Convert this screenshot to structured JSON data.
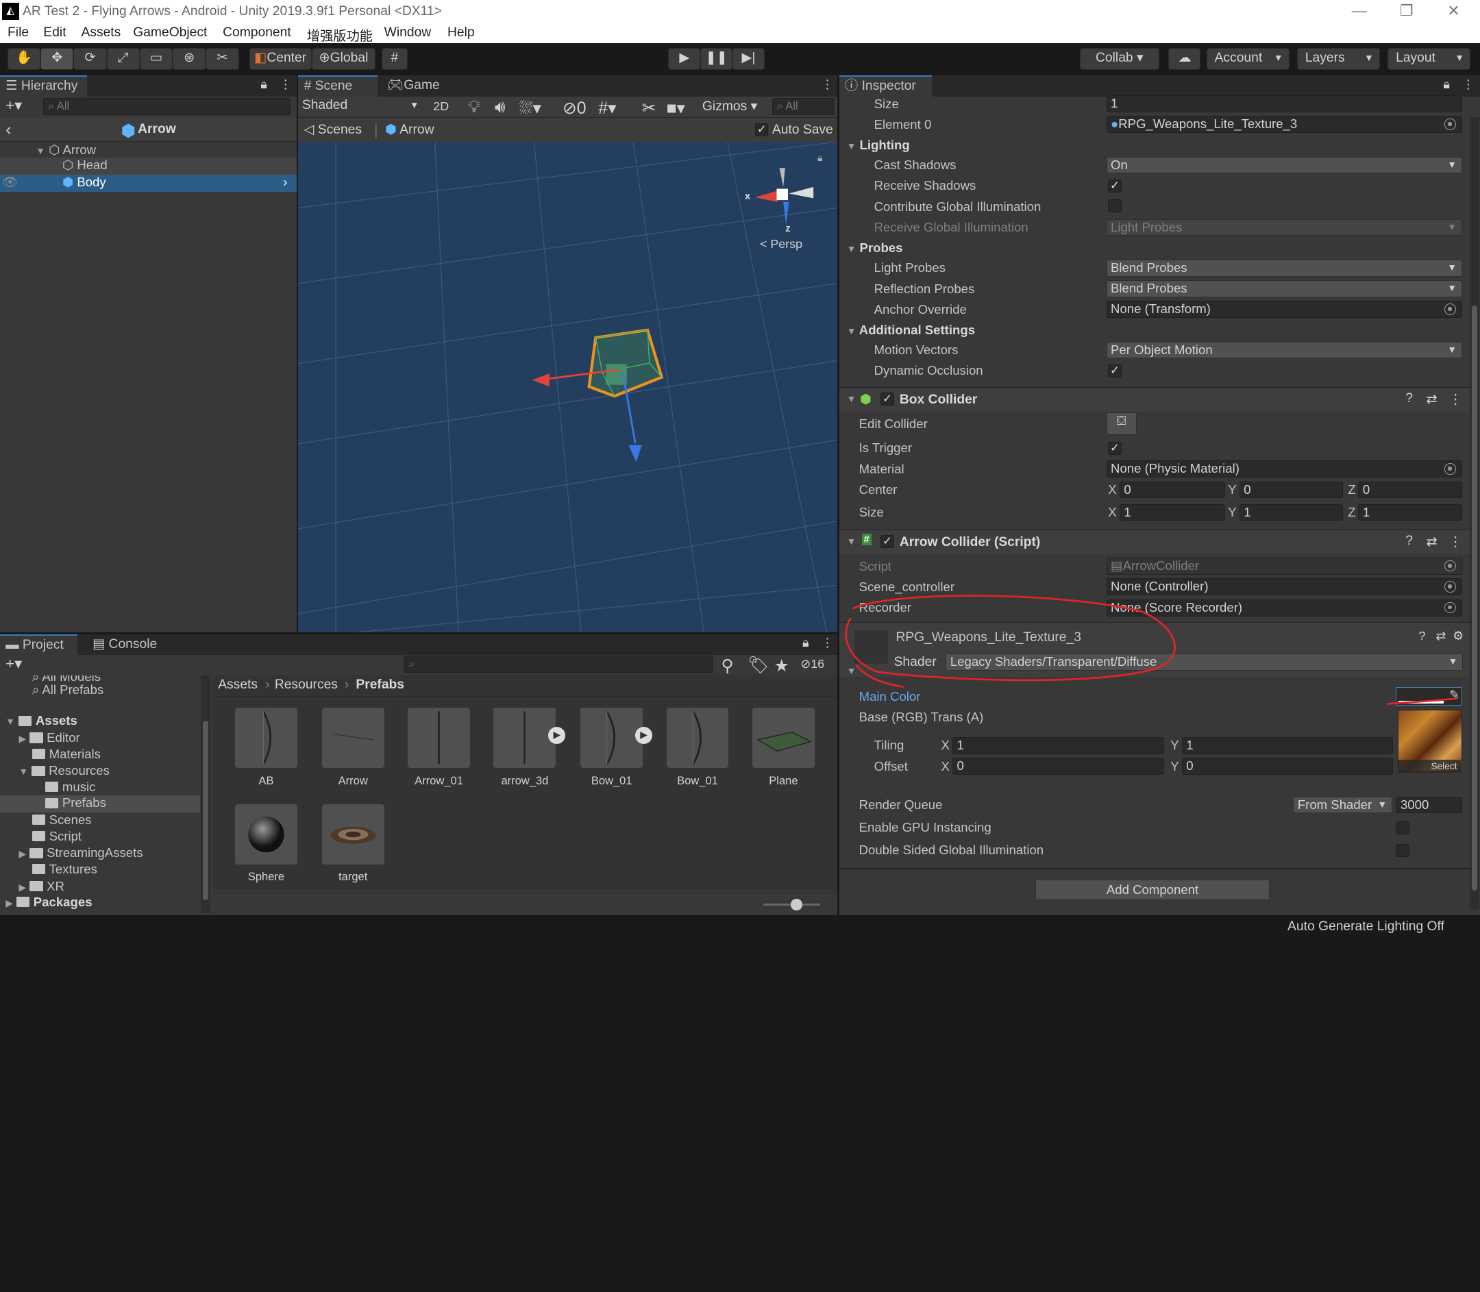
{
  "window": {
    "title": "AR Test 2 - Flying Arrows - Android - Unity 2019.3.9f1 Personal <DX11>",
    "icon": "unity-logo-icon"
  },
  "menu": [
    "File",
    "Edit",
    "Assets",
    "GameObject",
    "Component",
    "增强版功能",
    "Window",
    "Help"
  ],
  "toolbar": {
    "pivot": "Center",
    "space": "Global",
    "collab": "Collab ▾",
    "account": "Account",
    "layers": "Layers",
    "layout": "Layout"
  },
  "hierarchy": {
    "tab": "Hierarchy",
    "search_placeholder": "All",
    "scene_title": "Arrow",
    "items": [
      {
        "label": "Arrow"
      },
      {
        "label": "Head"
      },
      {
        "label": "Body"
      }
    ]
  },
  "scene": {
    "tabs": [
      "Scene",
      "Game"
    ],
    "shading": "Shaded",
    "mode2d": "2D",
    "hidden_count": "0",
    "gizmos": "Gizmos",
    "search_placeholder": "All",
    "breadcrumb": [
      "Scenes",
      "Arrow"
    ],
    "autosave": "Auto Save",
    "persp": "Persp",
    "axis_x": "x",
    "axis_z": "z"
  },
  "project": {
    "tabs": [
      "Project",
      "Console"
    ],
    "badge": "16",
    "tree": [
      "All Models",
      "All Prefabs",
      "Assets",
      "Editor",
      "Materials",
      "Resources",
      "music",
      "Prefabs",
      "Scenes",
      "Script",
      "StreamingAssets",
      "Textures",
      "XR",
      "Packages"
    ],
    "breadcrumb": [
      "Assets",
      "Resources",
      "Prefabs"
    ],
    "assets": [
      "AB",
      "Arrow",
      "Arrow_01",
      "arrow_3d",
      "Bow_01",
      "Bow_01",
      "Plane",
      "Sphere",
      "target"
    ]
  },
  "inspector": {
    "tab": "Inspector",
    "size_label": "Size",
    "size_value": "1",
    "element_label": "Element 0",
    "element_value": "RPG_Weapons_Lite_Texture_3",
    "lighting": "Lighting",
    "cast_shadows": "Cast Shadows",
    "cast_shadows_value": "On",
    "receive_shadows": "Receive Shadows",
    "contribute_gi": "Contribute Global Illumination",
    "receive_gi": "Receive Global Illumination",
    "receive_gi_value": "Light Probes",
    "probes": "Probes",
    "light_probes": "Light Probes",
    "light_probes_value": "Blend Probes",
    "reflection_probes": "Reflection Probes",
    "reflection_probes_value": "Blend Probes",
    "anchor_override": "Anchor Override",
    "anchor_override_value": "None (Transform)",
    "additional": "Additional Settings",
    "motion_vectors": "Motion Vectors",
    "motion_vectors_value": "Per Object Motion",
    "dynamic_occlusion": "Dynamic Occlusion",
    "box_collider": "Box Collider",
    "edit_collider": "Edit Collider",
    "is_trigger": "Is Trigger",
    "material": "Material",
    "material_value": "None (Physic Material)",
    "center": "Center",
    "size": "Size",
    "center_x": "0",
    "center_y": "0",
    "center_z": "0",
    "size_x": "1",
    "size_y": "1",
    "size_z": "1",
    "lbl_x": "X",
    "lbl_y": "Y",
    "lbl_z": "Z",
    "arrow_collider": "Arrow Collider (Script)",
    "script": "Script",
    "script_value": "ArrowCollider",
    "scene_controller": "Scene_controller",
    "scene_controller_value": "None (Controller)",
    "recorder": "Recorder",
    "recorder_value": "None (Score Recorder)",
    "material_name": "RPG_Weapons_Lite_Texture_3",
    "shader": "Shader",
    "shader_value": "Legacy Shaders/Transparent/Diffuse",
    "main_color": "Main Color",
    "base_rgb": "Base (RGB) Trans (A)",
    "tiling": "Tiling",
    "offset": "Offset",
    "tiling_x": "1",
    "tiling_y": "1",
    "offset_x": "0",
    "offset_y": "0",
    "select": "Select",
    "render_queue": "Render Queue",
    "render_queue_mode": "From Shader",
    "render_queue_value": "3000",
    "gpu_instancing": "Enable GPU Instancing",
    "double_sided_gi": "Double Sided Global Illumination",
    "add_component": "Add Component"
  },
  "status": {
    "text": "Auto Generate Lighting Off"
  },
  "colors": {
    "accent": "#3a79bb",
    "annotation": "#e0242a",
    "scene_bg": "#233e5f"
  }
}
